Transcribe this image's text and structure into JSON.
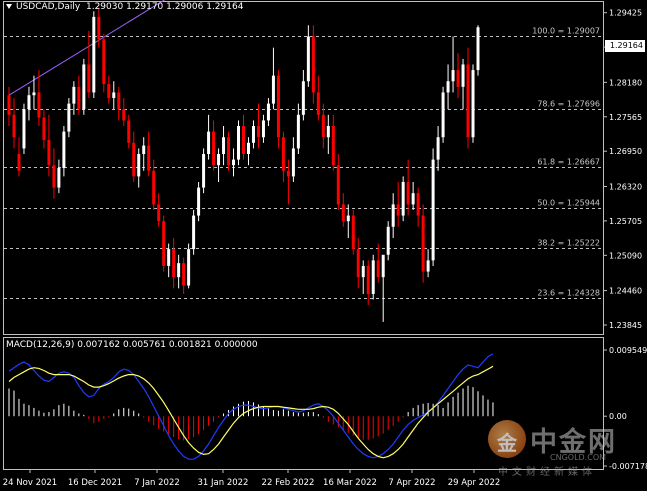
{
  "header": {
    "symbol": "USDCAD,Daily",
    "ohlc": "1.29030 1.29170 1.29006 1.29164"
  },
  "current_price_tag": "1.29164",
  "macd": {
    "title": "MACD(12,26,9) 0.007162 0.005761 0.001821 0.000000"
  },
  "watermark": {
    "brand_cn": "中金网",
    "icon_char": "金",
    "url": "CNGOLD.COM",
    "slogan": "中文财经新媒体"
  },
  "colors": {
    "background": "#000000",
    "bull": "#ffffff",
    "bear": "#ff0000",
    "grid_fib": "#c0c0c0",
    "macd_main": "#1f3cff",
    "macd_signal": "#ffff66",
    "trendline": "#a060ff"
  },
  "chart_data": [
    {
      "type": "candlestick",
      "title": "USDCAD,Daily",
      "y_ticks": [
        "1.29425",
        "1.28810",
        "1.28180",
        "1.27565",
        "1.26950",
        "1.26320",
        "1.25705",
        "1.25090",
        "1.24460",
        "1.23845"
      ],
      "x_ticks": [
        "24 Nov 2021",
        "16 Dec 2021",
        "7 Jan 2022",
        "31 Jan 2022",
        "22 Feb 2022",
        "16 Mar 2022",
        "7 Apr 2022",
        "29 Apr 2022"
      ],
      "ylim": [
        1.2372,
        1.2958
      ],
      "fib_levels": [
        {
          "label": "100.0 = 1.29007",
          "value": 1.29007
        },
        {
          "label": "78.6 = 1.27696",
          "value": 1.27696
        },
        {
          "label": "61.8 = 1.26667",
          "value": 1.26667
        },
        {
          "label": "50.0 = 1.25944",
          "value": 1.25944
        },
        {
          "label": "38.2 = 1.25222",
          "value": 1.25222
        },
        {
          "label": "23.6 = 1.24328",
          "value": 1.24328
        }
      ],
      "last_close": 1.29164,
      "trendline": [
        [
          0,
          1.2795
        ],
        [
          27,
          1.2958
        ]
      ],
      "candles": [
        [
          1.2795,
          1.281,
          1.274,
          1.276
        ],
        [
          1.276,
          1.279,
          1.27,
          1.272
        ],
        [
          1.269,
          1.272,
          1.265,
          1.266
        ],
        [
          1.27,
          1.278,
          1.269,
          1.277
        ],
        [
          1.277,
          1.281,
          1.275,
          1.2795
        ],
        [
          1.2795,
          1.283,
          1.277,
          1.28
        ],
        [
          1.28,
          1.284,
          1.274,
          1.2755
        ],
        [
          1.2755,
          1.277,
          1.27,
          1.2715
        ],
        [
          1.2715,
          1.276,
          1.265,
          1.267
        ],
        [
          1.267,
          1.27,
          1.261,
          1.263
        ],
        [
          1.263,
          1.268,
          1.262,
          1.2665
        ],
        [
          1.2665,
          1.274,
          1.265,
          1.273
        ],
        [
          1.273,
          1.279,
          1.272,
          1.278
        ],
        [
          1.278,
          1.282,
          1.276,
          1.281
        ],
        [
          1.281,
          1.283,
          1.276,
          1.277
        ],
        [
          1.277,
          1.286,
          1.276,
          1.285
        ],
        [
          1.285,
          1.291,
          1.279,
          1.28
        ],
        [
          1.28,
          1.2945,
          1.279,
          1.2935
        ],
        [
          1.2935,
          1.295,
          1.288,
          1.2895
        ],
        [
          1.2895,
          1.2905,
          1.28,
          1.2815
        ],
        [
          1.2815,
          1.283,
          1.278,
          1.279
        ],
        [
          1.279,
          1.282,
          1.277,
          1.28
        ],
        [
          1.28,
          1.281,
          1.275,
          1.277
        ],
        [
          1.277,
          1.279,
          1.274,
          1.275
        ],
        [
          1.275,
          1.276,
          1.27,
          1.271
        ],
        [
          1.271,
          1.273,
          1.264,
          1.265
        ],
        [
          1.265,
          1.27,
          1.263,
          1.269
        ],
        [
          1.269,
          1.272,
          1.266,
          1.2705
        ],
        [
          1.2705,
          1.273,
          1.265,
          1.266
        ],
        [
          1.266,
          1.268,
          1.259,
          1.26
        ],
        [
          1.26,
          1.262,
          1.256,
          1.257
        ],
        [
          1.257,
          1.258,
          1.248,
          1.249
        ],
        [
          1.249,
          1.253,
          1.247,
          1.252
        ],
        [
          1.252,
          1.254,
          1.245,
          1.247
        ],
        [
          1.247,
          1.251,
          1.245,
          1.2495
        ],
        [
          1.2495,
          1.2505,
          1.244,
          1.2455
        ],
        [
          1.2455,
          1.253,
          1.245,
          1.252
        ],
        [
          1.252,
          1.259,
          1.251,
          1.258
        ],
        [
          1.258,
          1.264,
          1.257,
          1.263
        ],
        [
          1.263,
          1.27,
          1.262,
          1.269
        ],
        [
          1.269,
          1.276,
          1.268,
          1.273
        ],
        [
          1.273,
          1.275,
          1.266,
          1.267
        ],
        [
          1.267,
          1.27,
          1.264,
          1.269
        ],
        [
          1.269,
          1.274,
          1.267,
          1.272
        ],
        [
          1.272,
          1.273,
          1.266,
          1.267
        ],
        [
          1.267,
          1.27,
          1.265,
          1.268
        ],
        [
          1.268,
          1.275,
          1.267,
          1.274
        ],
        [
          1.274,
          1.276,
          1.268,
          1.269
        ],
        [
          1.269,
          1.272,
          1.267,
          1.271
        ],
        [
          1.271,
          1.275,
          1.27,
          1.274
        ],
        [
          1.274,
          1.278,
          1.27,
          1.272
        ],
        [
          1.272,
          1.276,
          1.271,
          1.275
        ],
        [
          1.275,
          1.279,
          1.274,
          1.278
        ],
        [
          1.278,
          1.288,
          1.277,
          1.283
        ],
        [
          1.283,
          1.284,
          1.27,
          1.272
        ],
        [
          1.272,
          1.273,
          1.264,
          1.266
        ],
        [
          1.266,
          1.268,
          1.26,
          1.265
        ],
        [
          1.265,
          1.272,
          1.264,
          1.27
        ],
        [
          1.27,
          1.278,
          1.269,
          1.276
        ],
        [
          1.276,
          1.284,
          1.275,
          1.282
        ],
        [
          1.282,
          1.292,
          1.281,
          1.29
        ],
        [
          1.29,
          1.292,
          1.278,
          1.28
        ],
        [
          1.28,
          1.283,
          1.275,
          1.276
        ],
        [
          1.276,
          1.278,
          1.27,
          1.272
        ],
        [
          1.272,
          1.276,
          1.269,
          1.274
        ],
        [
          1.274,
          1.276,
          1.266,
          1.267
        ],
        [
          1.267,
          1.269,
          1.259,
          1.26
        ],
        [
          1.26,
          1.262,
          1.256,
          1.257
        ],
        [
          1.257,
          1.26,
          1.254,
          1.258
        ],
        [
          1.258,
          1.259,
          1.251,
          1.252
        ],
        [
          1.252,
          1.254,
          1.245,
          1.247
        ],
        [
          1.247,
          1.25,
          1.244,
          1.249
        ],
        [
          1.249,
          1.25,
          1.242,
          1.244
        ],
        [
          1.244,
          1.251,
          1.243,
          1.25
        ],
        [
          1.25,
          1.253,
          1.246,
          1.247
        ],
        [
          1.247,
          1.25,
          1.239,
          1.251
        ],
        [
          1.251,
          1.257,
          1.25,
          1.256
        ],
        [
          1.256,
          1.262,
          1.254,
          1.26
        ],
        [
          1.26,
          1.264,
          1.256,
          1.258
        ],
        [
          1.258,
          1.265,
          1.257,
          1.264
        ],
        [
          1.264,
          1.268,
          1.258,
          1.26
        ],
        [
          1.26,
          1.264,
          1.259,
          1.262
        ],
        [
          1.262,
          1.263,
          1.256,
          1.258
        ],
        [
          1.258,
          1.26,
          1.246,
          1.248
        ],
        [
          1.248,
          1.252,
          1.247,
          1.25
        ],
        [
          1.25,
          1.27,
          1.249,
          1.268
        ],
        [
          1.268,
          1.274,
          1.266,
          1.272
        ],
        [
          1.272,
          1.281,
          1.271,
          1.28
        ],
        [
          1.28,
          1.285,
          1.277,
          1.282
        ],
        [
          1.282,
          1.29,
          1.28,
          1.284
        ],
        [
          1.284,
          1.287,
          1.279,
          1.281
        ],
        [
          1.281,
          1.286,
          1.277,
          1.285
        ],
        [
          1.285,
          1.288,
          1.27,
          1.272
        ],
        [
          1.272,
          1.285,
          1.271,
          1.284
        ],
        [
          1.284,
          1.292,
          1.283,
          1.29164
        ]
      ]
    },
    {
      "type": "bar",
      "title": "MACD(12,26,9) 0.007162 0.005761 0.001821 0.000000",
      "y_ticks": [
        "0.009549",
        "0.00",
        "-0.007178"
      ],
      "ylim": [
        -0.007178,
        0.009549
      ],
      "series": [
        {
          "name": "histogram",
          "values": [
            0.004,
            0.0037,
            0.0025,
            0.0018,
            0.0016,
            0.0012,
            0.0008,
            0.0005,
            0.0006,
            0.001,
            0.0016,
            0.0018,
            0.0015,
            0.0008,
            0.0004,
            0.0002,
            -0.0004,
            -0.001,
            -0.0008,
            -0.0004,
            -0.0002,
            0.0004,
            0.001,
            0.0012,
            0.0011,
            0.0008,
            0.0004,
            -0.0002,
            -0.0008,
            -0.0013,
            -0.0018,
            -0.0022,
            -0.0026,
            -0.003,
            -0.0033,
            -0.0035,
            -0.0033,
            -0.003,
            -0.0026,
            -0.002,
            -0.0014,
            -0.0008,
            -0.0002,
            0.0004,
            0.0009,
            0.0014,
            0.0018,
            0.0021,
            0.0022,
            0.002,
            0.0017,
            0.0014,
            0.0011,
            0.0009,
            0.0008,
            0.001,
            0.0008,
            0.0006,
            0.0005,
            0.0005,
            0.0006,
            0.0006,
            0.0003,
            -0.0002,
            -0.0008,
            -0.0012,
            -0.0016,
            -0.002,
            -0.0024,
            -0.0028,
            -0.0032,
            -0.0034,
            -0.0034,
            -0.0032,
            -0.0029,
            -0.0025,
            -0.002,
            -0.0014,
            -0.0008,
            -0.0002,
            0.0006,
            0.0012,
            0.0016,
            0.0018,
            0.0019,
            0.0018,
            0.0016,
            0.0012,
            0.002,
            0.0028,
            0.0034,
            0.004,
            0.0044,
            0.0042,
            0.0036,
            0.003,
            0.0024,
            0.002
          ]
        },
        {
          "name": "main",
          "values": [
            0.0065,
            0.007,
            0.0075,
            0.0078,
            0.0074,
            0.0066,
            0.0058,
            0.0052,
            0.005,
            0.0056,
            0.0062,
            0.0064,
            0.0062,
            0.0056,
            0.0044,
            0.0034,
            0.0028,
            0.003,
            0.004,
            0.0046,
            0.005,
            0.0056,
            0.0064,
            0.0068,
            0.0066,
            0.006,
            0.005,
            0.004,
            0.0028,
            0.0014,
            0.0,
            -0.0014,
            -0.0028,
            -0.004,
            -0.005,
            -0.0058,
            -0.0062,
            -0.0062,
            -0.0058,
            -0.005,
            -0.004,
            -0.0028,
            -0.0016,
            -0.0006,
            0.0004,
            0.001,
            0.0014,
            0.0016,
            0.0016,
            0.0014,
            0.0012,
            0.0011,
            0.0012,
            0.0014,
            0.0014,
            0.0012,
            0.001,
            0.0008,
            0.0006,
            0.0008,
            0.0012,
            0.0016,
            0.0018,
            0.0014,
            0.0008,
            0.0,
            -0.001,
            -0.002,
            -0.003,
            -0.004,
            -0.0048,
            -0.0054,
            -0.0058,
            -0.006,
            -0.0058,
            -0.0054,
            -0.0048,
            -0.004,
            -0.003,
            -0.002,
            -0.0012,
            -0.0006,
            -0.0002,
            0.0002,
            0.0006,
            0.0012,
            0.002,
            0.003,
            0.004,
            0.005,
            0.006,
            0.0068,
            0.0074,
            0.0072,
            0.007,
            0.0078,
            0.0086,
            0.009
          ]
        },
        {
          "name": "signal",
          "values": [
            0.005,
            0.0056,
            0.006,
            0.0064,
            0.0068,
            0.007,
            0.0069,
            0.0066,
            0.0062,
            0.006,
            0.006,
            0.006,
            0.006,
            0.0058,
            0.0054,
            0.005,
            0.0045,
            0.0042,
            0.0042,
            0.0044,
            0.0047,
            0.0051,
            0.0055,
            0.0058,
            0.006,
            0.006,
            0.0058,
            0.0054,
            0.0048,
            0.004,
            0.003,
            0.002,
            0.0008,
            -0.0004,
            -0.0016,
            -0.0028,
            -0.0038,
            -0.0046,
            -0.0052,
            -0.0055,
            -0.0054,
            -0.0048,
            -0.004,
            -0.003,
            -0.002,
            -0.001,
            -0.0002,
            0.0004,
            0.0008,
            0.0011,
            0.0013,
            0.0014,
            0.0014,
            0.0014,
            0.0014,
            0.0013,
            0.0012,
            0.0011,
            0.001,
            0.001,
            0.001,
            0.0011,
            0.0013,
            0.0014,
            0.0013,
            0.001,
            0.0004,
            -0.0004,
            -0.0012,
            -0.0022,
            -0.0032,
            -0.004,
            -0.0048,
            -0.0054,
            -0.0058,
            -0.006,
            -0.0058,
            -0.0054,
            -0.0048,
            -0.004,
            -0.003,
            -0.002,
            -0.001,
            -0.0002,
            0.0006,
            0.0012,
            0.0018,
            0.0024,
            0.003,
            0.0036,
            0.0042,
            0.0048,
            0.0054,
            0.0058,
            0.006,
            0.0064,
            0.0068,
            0.0072
          ]
        }
      ]
    }
  ]
}
